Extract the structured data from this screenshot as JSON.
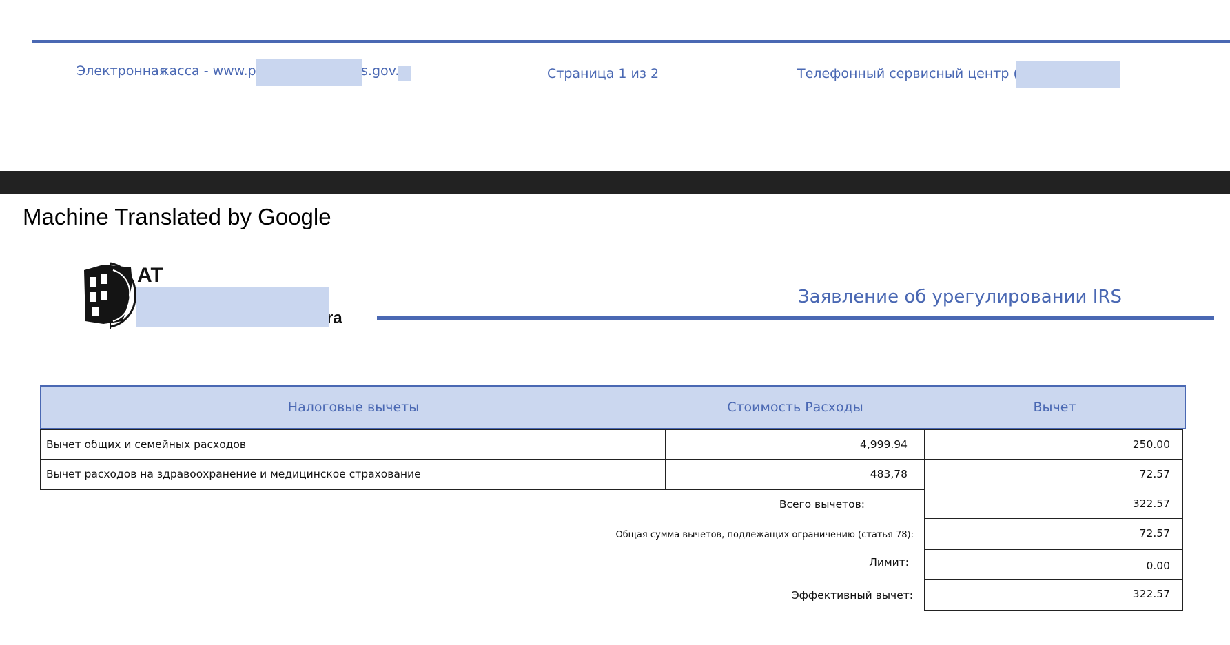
{
  "footer": {
    "cash_office_text": "Электронная",
    "cash_office_link": "касса - www.p",
    "cash_office_tail": "s.gov.",
    "page_indicator": "Страница 1 из 2",
    "phone_center": "Телефонный сервисный центр (+"
  },
  "translation_banner": "Machine Translated by Google",
  "logo": {
    "abbr": "AT",
    "name_tail": "ra"
  },
  "document_title": "Заявление об урегулировании IRS",
  "table": {
    "headers": [
      "Налоговые вычеты",
      "Стоимость Расходы",
      "Вычет"
    ],
    "rows": [
      {
        "label": "Вычет общих и семейных расходов",
        "cost": "4,999.94",
        "deduction": "250.00"
      },
      {
        "label": "Вычет расходов на здравоохранение и медицинское страхование",
        "cost": "483,78",
        "deduction": "72.57"
      }
    ],
    "summary": [
      {
        "label": "Всего вычетов:",
        "value": "322.57"
      },
      {
        "label": "Общая сумма вычетов, подлежащих ограничению (статья 78):",
        "value": "72.57"
      },
      {
        "label": "Лимит:",
        "value": "0.00"
      },
      {
        "label": "Эффективный вычет:",
        "value": "322.57"
      }
    ]
  },
  "colors": {
    "accent": "#4a68b3",
    "header_fill": "#cbd7ef",
    "redaction": "#c9d6ef",
    "separator": "#222222"
  }
}
